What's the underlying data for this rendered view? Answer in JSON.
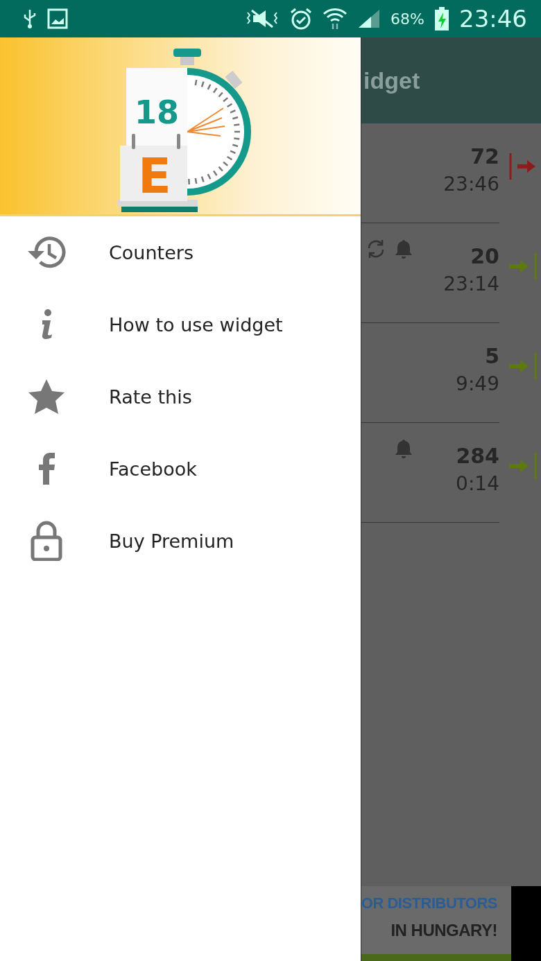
{
  "status_bar": {
    "battery": "68%",
    "time": "23:46"
  },
  "app_bar": {
    "title": "idget"
  },
  "counters": [
    {
      "count": "72",
      "time": "23:46",
      "kind": "exit",
      "repeat": false,
      "alarm": false
    },
    {
      "count": "20",
      "time": "23:14",
      "kind": "enter",
      "repeat": true,
      "alarm": true
    },
    {
      "count": "5",
      "time": "9:49",
      "kind": "enter",
      "repeat": false,
      "alarm": false
    },
    {
      "count": "284",
      "time": "0:14",
      "kind": "enter",
      "repeat": false,
      "alarm": true
    }
  ],
  "ad": {
    "lines": [
      "OR DISTRIBUTORS",
      "IN HUNGARY!"
    ]
  },
  "drawer": {
    "logo": {
      "day": "18",
      "letter": "E"
    },
    "items": [
      {
        "kind": "history",
        "label": "Counters"
      },
      {
        "kind": "info",
        "label": "How to use widget"
      },
      {
        "kind": "star",
        "label": "Rate this"
      },
      {
        "kind": "facebook",
        "label": "Facebook"
      },
      {
        "kind": "lock",
        "label": "Buy Premium"
      }
    ]
  }
}
